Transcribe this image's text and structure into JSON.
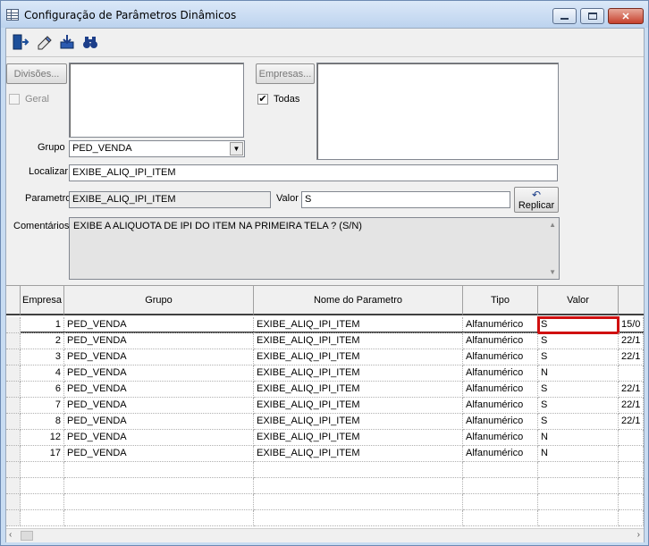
{
  "window": {
    "title": "Configuração de Parâmetros Dinâmicos",
    "close": "✕"
  },
  "filters": {
    "divisoes_label": "Divisões...",
    "geral_label": "Geral",
    "empresas_label": "Empresas...",
    "todas_label": "Todas",
    "todas_checked": "✔",
    "grupo_label": "Grupo",
    "grupo_value": "PED_VENDA",
    "localizar_label": "Localizar",
    "localizar_value": "EXIBE_ALIQ_IPI_ITEM",
    "parametro_label": "Parametro",
    "parametro_value": "EXIBE_ALIQ_IPI_ITEM",
    "valor_label": "Valor",
    "valor_value": "S",
    "replicar_label": "Replicar",
    "comentarios_label": "Comentários",
    "comentarios_value": "EXIBE A ALIQUOTA DE IPI DO ITEM NA PRIMEIRA TELA ? (S/N)"
  },
  "table": {
    "columns": [
      "Empresa",
      "Grupo",
      "Nome do Parametro",
      "Tipo",
      "Valor"
    ],
    "rows": [
      [
        "1",
        "PED_VENDA",
        "EXIBE_ALIQ_IPI_ITEM",
        "Alfanumérico",
        "S",
        "15/0"
      ],
      [
        "2",
        "PED_VENDA",
        "EXIBE_ALIQ_IPI_ITEM",
        "Alfanumérico",
        "S",
        "22/1"
      ],
      [
        "3",
        "PED_VENDA",
        "EXIBE_ALIQ_IPI_ITEM",
        "Alfanumérico",
        "S",
        "22/1"
      ],
      [
        "4",
        "PED_VENDA",
        "EXIBE_ALIQ_IPI_ITEM",
        "Alfanumérico",
        "N",
        ""
      ],
      [
        "6",
        "PED_VENDA",
        "EXIBE_ALIQ_IPI_ITEM",
        "Alfanumérico",
        "S",
        "22/1"
      ],
      [
        "7",
        "PED_VENDA",
        "EXIBE_ALIQ_IPI_ITEM",
        "Alfanumérico",
        "S",
        "22/1"
      ],
      [
        "8",
        "PED_VENDA",
        "EXIBE_ALIQ_IPI_ITEM",
        "Alfanumérico",
        "S",
        "22/1"
      ],
      [
        "12",
        "PED_VENDA",
        "EXIBE_ALIQ_IPI_ITEM",
        "Alfanumérico",
        "N",
        ""
      ],
      [
        "17",
        "PED_VENDA",
        "EXIBE_ALIQ_IPI_ITEM",
        "Alfanumérico",
        "N",
        ""
      ]
    ]
  },
  "icons": {
    "toolbar": [
      "exit-icon",
      "eraser-icon",
      "save-icon",
      "binoculars-icon"
    ]
  },
  "colors": {
    "selection": "#d01010",
    "title_bg": "#c8dcf2",
    "close_button": "#c6402c"
  }
}
